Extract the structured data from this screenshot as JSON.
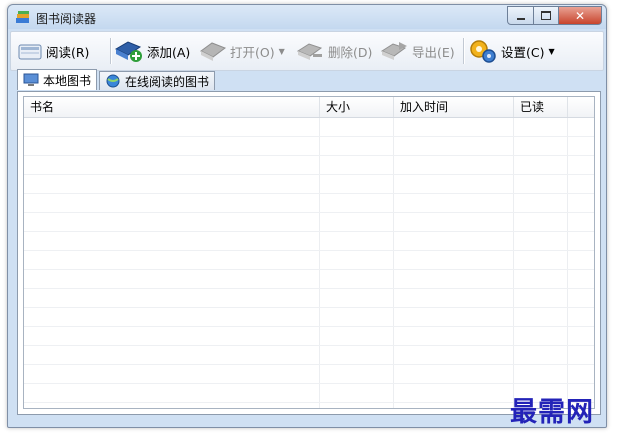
{
  "window": {
    "title": "图书阅读器"
  },
  "toolbar": {
    "read": "阅读(R)",
    "add": "添加(A)",
    "open": "打开(O)",
    "delete": "删除(D)",
    "export": "导出(E)",
    "settings": "设置(C)"
  },
  "tabs": [
    {
      "label": "本地图书",
      "active": true
    },
    {
      "label": "在线阅读的图书",
      "active": false
    }
  ],
  "table": {
    "columns": [
      "书名",
      "大小",
      "加入时间",
      "已读"
    ],
    "rows": []
  },
  "watermark": "最需网"
}
